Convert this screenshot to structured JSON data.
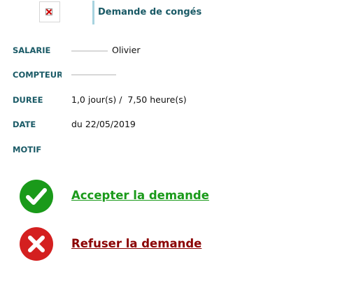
{
  "header": {
    "title": "Demande de congés"
  },
  "fields": {
    "salarie": {
      "label": "SALARIE",
      "value": "Olivier"
    },
    "compteur": {
      "label": "COMPTEUR",
      "value": ""
    },
    "duree": {
      "label": "DUREE",
      "value": "1,0 jour(s) /  7,50 heure(s)"
    },
    "date": {
      "label": "DATE",
      "value": "du 22/05/2019"
    },
    "motif": {
      "label": "MOTIF",
      "value": ""
    }
  },
  "actions": {
    "accept": {
      "label": "Accepter la demande",
      "icon": "check-icon",
      "color": "#1a9a1a"
    },
    "refuse": {
      "label": "Refuser la demande",
      "icon": "cross-icon",
      "color": "#8b0000"
    }
  }
}
